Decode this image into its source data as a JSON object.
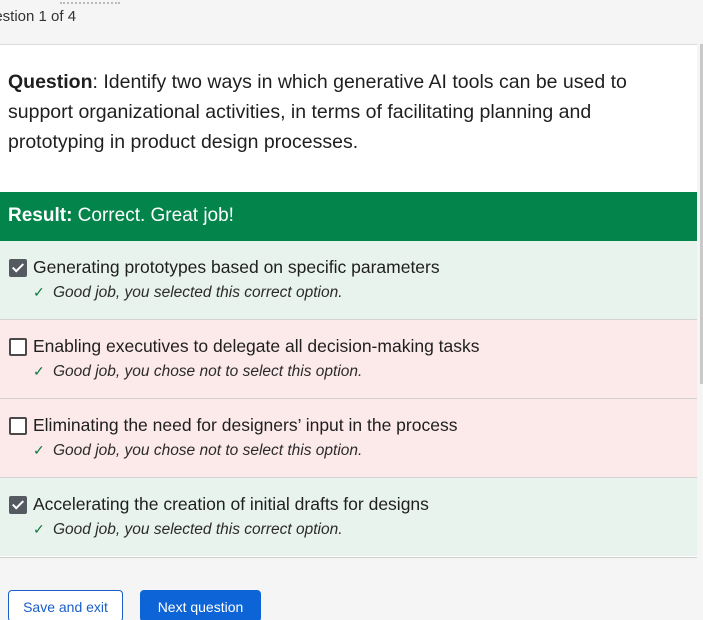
{
  "header": {
    "question_counter": "uestion 1 of 4"
  },
  "question": {
    "label": "Question",
    "text": ": Identify two ways in which generative AI tools can be used to support organizational activities, in terms of facilitating planning and prototyping in product design processes."
  },
  "result": {
    "label": "Result:",
    "text": " Correct. Great job!",
    "color": "#02844b"
  },
  "options": [
    {
      "label": "Generating prototypes based on specific parameters",
      "checked": true,
      "feedback": "Good job, you selected this correct option.",
      "status": "correct"
    },
    {
      "label": "Enabling executives to delegate all decision-making tasks",
      "checked": false,
      "feedback": "Good job, you chose not to select this option.",
      "status": "incorrect"
    },
    {
      "label": "Eliminating the need for designers’ input in the process",
      "checked": false,
      "feedback": "Good job, you chose not to select this option.",
      "status": "incorrect"
    },
    {
      "label": "Accelerating the creation of initial drafts for designs",
      "checked": true,
      "feedback": "Good job, you selected this correct option.",
      "status": "correct"
    }
  ],
  "icons": {
    "feedback": "checkmark-icon",
    "checked_box": "checkbox-checked-icon",
    "unchecked_box": "checkbox-unchecked-icon"
  },
  "buttons": {
    "save_exit": "Save and exit",
    "next": "Next question"
  },
  "colors": {
    "correct_bg": "#e7f3ec",
    "incorrect_bg": "#fce9ea",
    "primary": "#0d64d6"
  }
}
